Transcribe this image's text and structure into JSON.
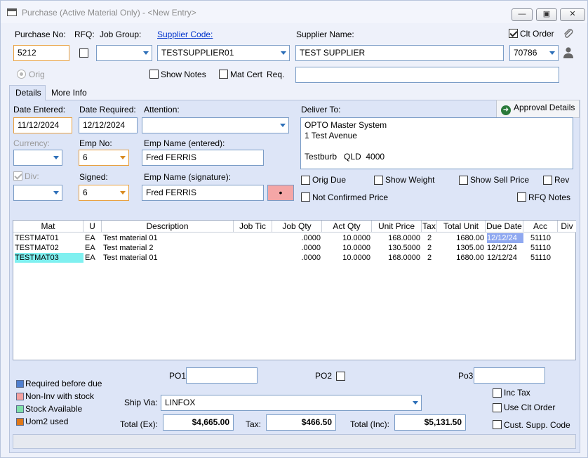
{
  "window": {
    "title": "Purchase (Active Material Only) - <New Entry>"
  },
  "header": {
    "purchase_no_label": "Purchase No:",
    "purchase_no": "5212",
    "rfq_label": "RFQ:",
    "job_group_label": "Job Group:",
    "job_group": "",
    "supplier_code_label": "Supplier Code:",
    "supplier_code": "TESTSUPPLIER01",
    "supplier_name_label": "Supplier Name:",
    "supplier_name": "TEST SUPPLIER",
    "clt_order_label": "Clt Order",
    "clt_order_value": "70786",
    "orig_label": "Orig",
    "show_notes_label": "Show Notes",
    "mat_cert_label": "Mat Cert",
    "req_label": "Req.",
    "mat_cert_value": ""
  },
  "tabs": [
    {
      "label": "Details"
    },
    {
      "label": "More Info"
    }
  ],
  "details": {
    "date_entered_label": "Date Entered:",
    "date_entered": "11/12/2024",
    "date_required_label": "Date Required:",
    "date_required": "12/12/2024",
    "attention_label": "Attention:",
    "attention": "",
    "deliver_to_label": "Deliver To:",
    "deliver_to": "OPTO Master System\n1 Test Avenue\n\nTestburb   QLD  4000",
    "approval_label": "Approval Details",
    "currency_label": "Currency:",
    "currency": "",
    "emp_no_label": "Emp No:",
    "emp_no": "6",
    "emp_name_entered_label": "Emp Name (entered):",
    "emp_name_entered": "Fred FERRIS",
    "div_label": "Div:",
    "div": "",
    "signed_label": "Signed:",
    "signed": "6",
    "emp_name_signature_label": "Emp Name (signature):",
    "emp_name_signature": "Fred FERRIS",
    "signature_dot": "•",
    "orig_due_label": "Orig Due",
    "show_weight_label": "Show Weight",
    "show_sell_price_label": "Show Sell Price",
    "rev_label": "Rev",
    "not_confirmed_label": "Not Confirmed Price",
    "rfq_notes_label": "RFQ Notes"
  },
  "grid": {
    "columns": [
      "Mat",
      "U",
      "Description",
      "Job Tic",
      "Job Qty",
      "Act Qty",
      "Unit Price",
      "Tax",
      "Total Unit",
      "Due Date",
      "Acc",
      "Div"
    ],
    "rows": [
      [
        "TESTMAT01",
        "EA",
        "Test material 01",
        "",
        ".0000",
        "10.0000",
        "168.0000",
        "2",
        "1680.00",
        "12/12/24",
        "51110",
        ""
      ],
      [
        "TESTMAT02",
        "EA",
        "Test material 2",
        "",
        ".0000",
        "10.0000",
        "130.5000",
        "2",
        "1305.00",
        "12/12/24",
        "51110",
        ""
      ],
      [
        "TESTMAT03",
        "EA",
        "Test material 01",
        "",
        ".0000",
        "10.0000",
        "168.0000",
        "2",
        "1680.00",
        "12/12/24",
        "51110",
        ""
      ]
    ]
  },
  "legend": [
    {
      "label": "Required before due",
      "color": "#4f7fd0"
    },
    {
      "label": "Non-Inv with stock",
      "color": "#f3a0a0"
    },
    {
      "label": "Stock Available",
      "color": "#7fe0a8"
    },
    {
      "label": "Uom2 used",
      "color": "#e07818"
    }
  ],
  "footer": {
    "po1_label": "PO1",
    "po1": "",
    "po2_label": "PO2",
    "po3_label": "Po3",
    "po3": "",
    "inc_tax_label": "Inc Tax",
    "use_clt_order_label": "Use Clt Order",
    "cust_supp_code_label": "Cust. Supp. Code",
    "ship_via_label": "Ship Via:",
    "ship_via": "LINFOX",
    "total_ex_label": "Total (Ex):",
    "total_ex": "$4,665.00",
    "tax_label": "Tax:",
    "tax": "$466.50",
    "total_inc_label": "Total (Inc):",
    "total_inc": "$5,131.50"
  },
  "colors": {
    "highlight_cyan": "#7ff0f0",
    "highlight_blue": "#8fa8f0",
    "signature_pink": "#f4a6a6",
    "accent_orange": "#e8a040"
  }
}
